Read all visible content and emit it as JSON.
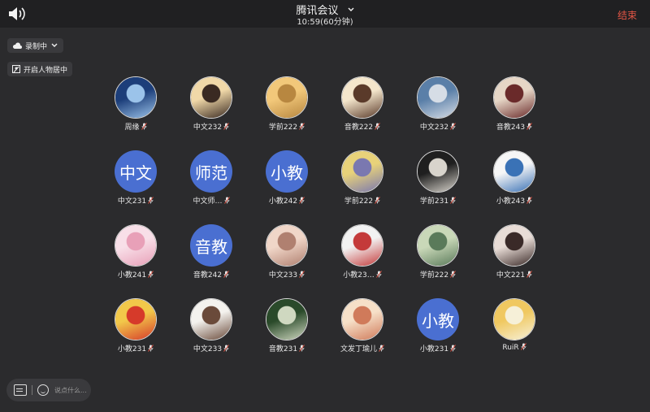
{
  "header": {
    "title": "腾讯会议",
    "subtitle": "10:59(60分钟)",
    "end_label": "结束"
  },
  "controls": {
    "recording_label": "录制中",
    "person_mode_label": "开启人物居中"
  },
  "participants": [
    {
      "name": "周缘",
      "avatar_text": "",
      "photo": [
        "#1c3e7a",
        "#9bc3ea"
      ]
    },
    {
      "name": "中文232",
      "avatar_text": "",
      "photo": [
        "#f0d8a8",
        "#3a2a22"
      ]
    },
    {
      "name": "学前222",
      "avatar_text": "",
      "photo": [
        "#f2c87a",
        "#b88740"
      ]
    },
    {
      "name": "音教222",
      "avatar_text": "",
      "photo": [
        "#f4e6cc",
        "#5a3a2a"
      ]
    },
    {
      "name": "中文232",
      "avatar_text": "",
      "photo": [
        "#5a7fa8",
        "#d6dde6"
      ]
    },
    {
      "name": "音教243",
      "avatar_text": "",
      "photo": [
        "#e6d6c6",
        "#6a2a2a"
      ]
    },
    {
      "name": "中文231",
      "avatar_text": "中文",
      "photo": []
    },
    {
      "name": "中文师…",
      "avatar_text": "师范",
      "photo": []
    },
    {
      "name": "小教242",
      "avatar_text": "小教",
      "photo": []
    },
    {
      "name": "学前222",
      "avatar_text": "",
      "photo": [
        "#e8d27a",
        "#7a78b0"
      ]
    },
    {
      "name": "学前231",
      "avatar_text": "",
      "photo": [
        "#1f1f1f",
        "#d8d4cc"
      ]
    },
    {
      "name": "小教243",
      "avatar_text": "",
      "photo": [
        "#f6f6f6",
        "#3a72b6"
      ]
    },
    {
      "name": "小教241",
      "avatar_text": "",
      "photo": [
        "#f8dfe8",
        "#e8a0b8"
      ]
    },
    {
      "name": "音教242",
      "avatar_text": "音教",
      "photo": []
    },
    {
      "name": "中文233",
      "avatar_text": "",
      "photo": [
        "#f0d6c8",
        "#b08070"
      ]
    },
    {
      "name": "小教23…",
      "avatar_text": "",
      "photo": [
        "#f2f2f2",
        "#c43a3a"
      ]
    },
    {
      "name": "学前222",
      "avatar_text": "",
      "photo": [
        "#c9d8b8",
        "#5a7a5a"
      ]
    },
    {
      "name": "中文221",
      "avatar_text": "",
      "photo": [
        "#e8dcd6",
        "#3a2a28"
      ]
    },
    {
      "name": "小教231",
      "avatar_text": "",
      "photo": [
        "#f2c84a",
        "#d63a2a"
      ]
    },
    {
      "name": "中文233",
      "avatar_text": "",
      "photo": [
        "#f4f2ee",
        "#6a4a3a"
      ]
    },
    {
      "name": "音教231",
      "avatar_text": "",
      "photo": [
        "#2a4a2a",
        "#cfd8c0"
      ]
    },
    {
      "name": "文发丁瑜儿",
      "avatar_text": "",
      "photo": [
        "#f6e0c8",
        "#d07a5a"
      ]
    },
    {
      "name": "小教231",
      "avatar_text": "小教",
      "photo": []
    },
    {
      "name": "RuiR",
      "avatar_text": "",
      "photo": [
        "#f0c860",
        "#f6f0d8"
      ]
    }
  ],
  "chat": {
    "placeholder": "说点什么..."
  },
  "colors": {
    "end": "#e25545",
    "text_avatar_bg": "#4a6fd1",
    "background": "#2b2b2d"
  },
  "icons": [
    "speaker-icon",
    "chevron-down-icon",
    "cloud-icon",
    "person-center-icon",
    "mic-muted-icon",
    "chat-icon",
    "emoji-icon"
  ]
}
